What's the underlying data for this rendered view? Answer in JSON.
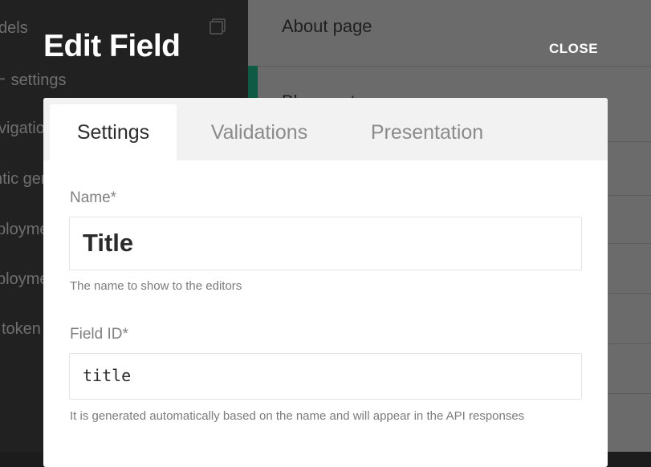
{
  "background": {
    "sidebar_items": [
      "dels",
      "settings",
      "vigatio",
      "ntic gen",
      "ployme",
      "ployme",
      "token"
    ],
    "list_rows": [
      "About page",
      "Blog post"
    ]
  },
  "modal": {
    "title": "Edit Field",
    "close_label": "CLOSE",
    "tabs": [
      {
        "label": "Settings",
        "active": true
      },
      {
        "label": "Validations",
        "active": false
      },
      {
        "label": "Presentation",
        "active": false
      }
    ],
    "name_field": {
      "label": "Name*",
      "value": "Title",
      "hint": "The name to show to the editors"
    },
    "field_id": {
      "label": "Field ID*",
      "value": "title",
      "hint": "It is generated automatically based on the name and will appear in the API responses"
    }
  },
  "colors": {
    "accent": "#0f5a45",
    "overlay": "#1c1c1c",
    "card": "#ffffff",
    "tab_bar": "#f2f2f2"
  },
  "icons": [
    "models-icon"
  ]
}
